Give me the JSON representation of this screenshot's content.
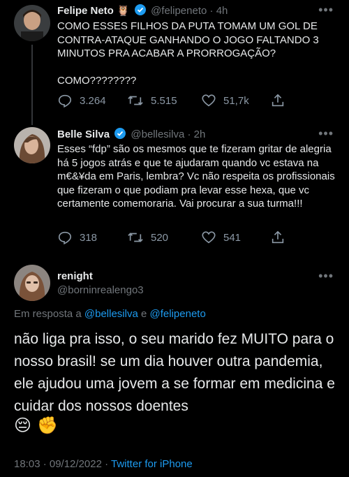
{
  "tweets": [
    {
      "name": "Felipe Neto",
      "badge_emoji": "🦉",
      "handle": "@felipeneto",
      "time": "4h",
      "text": "COMO ESSES FILHOS DA PUTA TOMAM UM GOL DE CONTRA-ATAQUE GANHANDO O JOGO FALTANDO 3 MINUTOS PRA ACABAR A PRORROGAÇÃO?\n\nCOMO????????",
      "replies": "3.264",
      "retweets": "5.515",
      "likes": "51,7k"
    },
    {
      "name": "Belle Silva",
      "handle": "@bellesilva",
      "time": "2h",
      "text": "Esses “fdp” são os mesmos que te fizeram gritar de alegria há 5 jogos atrás e que te ajudaram quando vc estava na m€&¥da em Paris, lembra? Vc não respeita os profissionais que fizeram o que podiam pra levar esse hexa, que vc certamente comemoraria. Vai procurar a sua turma!!!",
      "replies": "318",
      "retweets": "520",
      "likes": "541"
    }
  ],
  "main_tweet": {
    "name": "renight",
    "handle": "@borninrealengo3",
    "reply_prefix": "Em resposta a",
    "reply_user1": "@bellesilva",
    "reply_and": "e",
    "reply_user2": "@felipeneto",
    "text": "não liga pra isso, o seu marido fez MUITO para o nosso brasil! se um dia houver outra pandemia, ele ajudou uma jovem a se formar em medicina e cuidar dos nossos doentes",
    "emojis": [
      "😔",
      "✊"
    ],
    "timestamp": "18:03 · 09/12/2022 ·",
    "source": "Twitter for iPhone"
  },
  "more_label": "•••",
  "colors": {
    "background": "#000000",
    "text": "#e7e9ea",
    "muted": "#71767b",
    "accent": "#1d9bf0"
  }
}
